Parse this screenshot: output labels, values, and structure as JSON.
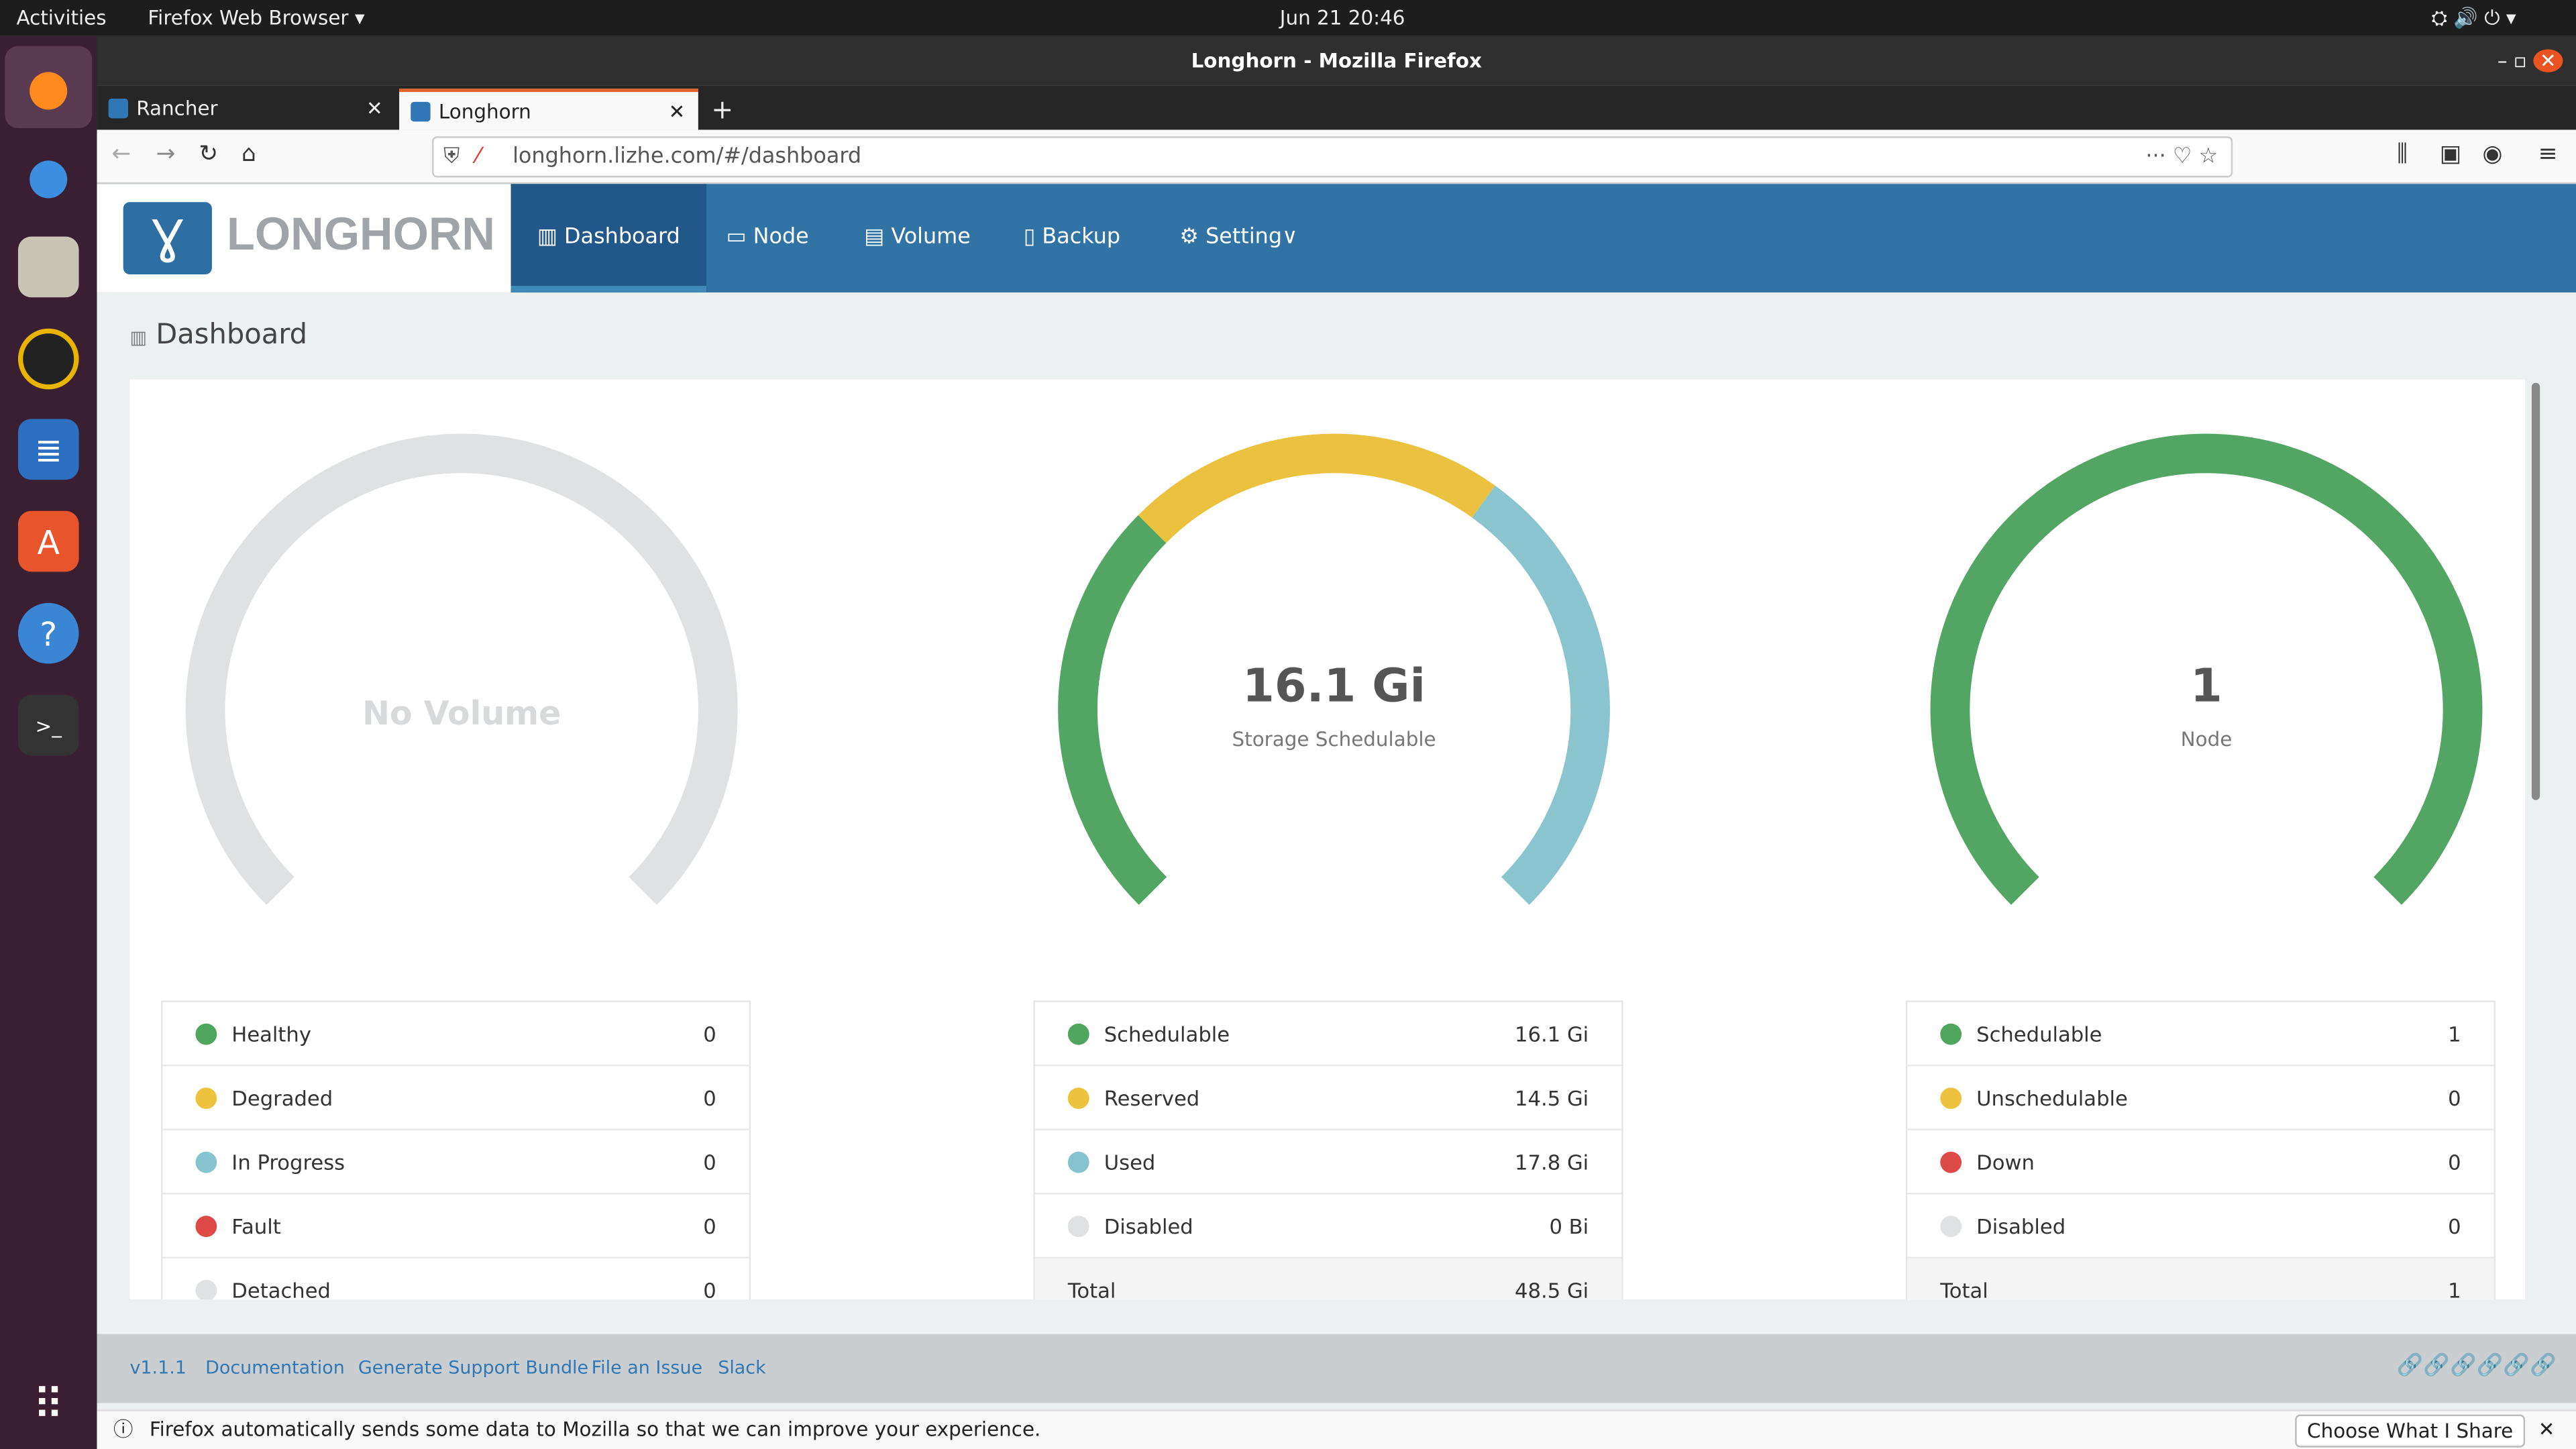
{
  "system": {
    "activities": "Activities",
    "app_menu": "Firefox Web Browser ▾",
    "clock": "Jun 21  20:46"
  },
  "window": {
    "title": "Longhorn - Mozilla Firefox"
  },
  "browser": {
    "tabs": [
      {
        "label": "Rancher"
      },
      {
        "label": "Longhorn"
      }
    ],
    "url": "longhorn.lizhe.com/#/dashboard"
  },
  "app": {
    "logo": "LONGHORN",
    "nav": [
      {
        "label": "Dashboard",
        "icon": "chart-icon"
      },
      {
        "label": "Node",
        "icon": "monitor-icon"
      },
      {
        "label": "Volume",
        "icon": "server-icon"
      },
      {
        "label": "Backup",
        "icon": "copy-icon"
      },
      {
        "label": "Setting",
        "icon": "gear-icon"
      }
    ],
    "page_title": "Dashboard"
  },
  "gauges": [
    {
      "center_text": "No Volume",
      "sub": "",
      "segments": [
        {
          "value": 1,
          "color": "#e0e1e3"
        }
      ],
      "legend": [
        {
          "label": "Healthy",
          "value": "0",
          "color": "#4fa55e"
        },
        {
          "label": "Degraded",
          "value": "0",
          "color": "#ecc23e"
        },
        {
          "label": "In Progress",
          "value": "0",
          "color": "#86c3cf"
        },
        {
          "label": "Fault",
          "value": "0",
          "color": "#de4a48"
        },
        {
          "label": "Detached",
          "value": "0",
          "color": "#e0e1e3"
        }
      ]
    },
    {
      "center_text": "16.1 Gi",
      "sub": "Storage Schedulable",
      "segments": [
        {
          "value": 16.1,
          "color": "#52a562"
        },
        {
          "value": 14.5,
          "color": "#ebc23f"
        },
        {
          "value": 17.8,
          "color": "#8ac5cf"
        }
      ],
      "legend": [
        {
          "label": "Schedulable",
          "value": "16.1 Gi",
          "color": "#4fa55e"
        },
        {
          "label": "Reserved",
          "value": "14.5 Gi",
          "color": "#ecc23e"
        },
        {
          "label": "Used",
          "value": "17.8 Gi",
          "color": "#86c3cf"
        },
        {
          "label": "Disabled",
          "value": "0 Bi",
          "color": "#e0e1e3"
        }
      ],
      "total": {
        "label": "Total",
        "value": "48.5 Gi"
      }
    },
    {
      "center_text": "1",
      "sub": "Node",
      "segments": [
        {
          "value": 1,
          "color": "#52a562"
        }
      ],
      "legend": [
        {
          "label": "Schedulable",
          "value": "1",
          "color": "#4fa55e"
        },
        {
          "label": "Unschedulable",
          "value": "0",
          "color": "#ecc23e"
        },
        {
          "label": "Down",
          "value": "0",
          "color": "#de4a48"
        },
        {
          "label": "Disabled",
          "value": "0",
          "color": "#e0e1e3"
        }
      ],
      "total": {
        "label": "Total",
        "value": "1"
      }
    }
  ],
  "footer": {
    "links": [
      "v1.1.1",
      "Documentation",
      "Generate Support Bundle",
      "File an Issue",
      "Slack"
    ]
  },
  "notification": {
    "text": "Firefox automatically sends some data to Mozilla so that we can improve your experience.",
    "button": "Choose What I Share"
  }
}
